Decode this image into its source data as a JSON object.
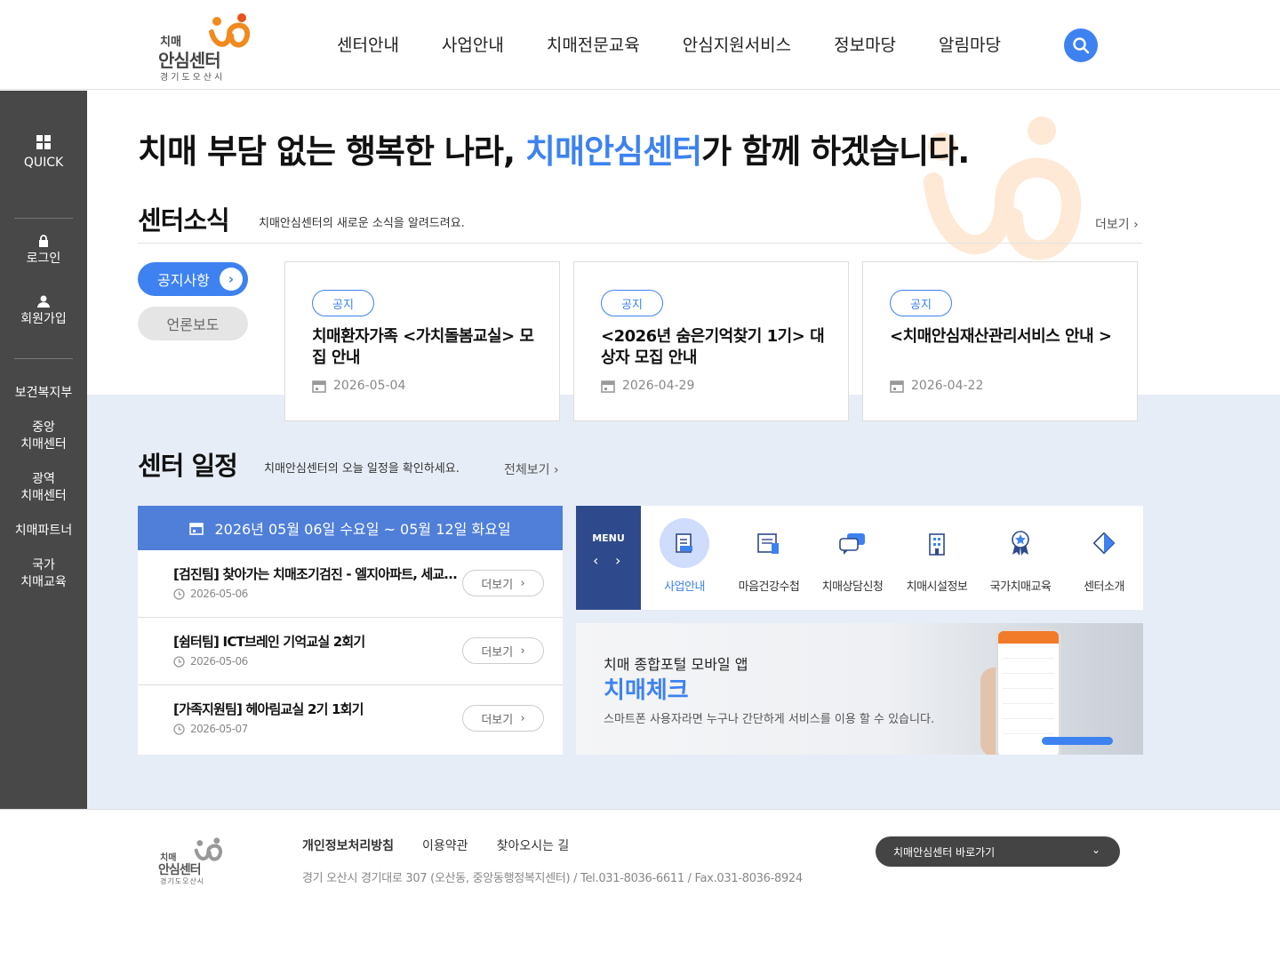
{
  "header": {
    "logo": {
      "line1": "치매",
      "line2": "안심센터",
      "line3": "경기도오산시"
    },
    "nav": [
      "센터안내",
      "사업안내",
      "치매전문교육",
      "안심지원서비스",
      "정보마당",
      "알림마당"
    ],
    "search_icon": "search-icon",
    "accent_color": "#3d82f0"
  },
  "sidebar": {
    "quick": "QUICK",
    "login": "로그인",
    "join": "회원가입",
    "links": [
      "보건복지부",
      "중앙\n치매센터",
      "광역\n치매센터",
      "치매파트너",
      "국가\n치매교육"
    ]
  },
  "hero": {
    "title_pre": "치매 부담 없는 행복한 나라, ",
    "title_hl": "치매안심센터",
    "title_post": "가 함께 하겠습니다."
  },
  "news": {
    "title": "센터소식",
    "desc": "치매안심센터의 새로운 소식을 알려드려요.",
    "more": "더보기",
    "tabs": [
      "공지사항",
      "언론보도"
    ],
    "cards": [
      {
        "badge": "공지",
        "title": "치매환자가족 <가치돌봄교실> 모집 안내",
        "date": "2026-05-04"
      },
      {
        "badge": "공지",
        "title": "<2026년 숨은기억찾기 1기> 대상자 모집 안내",
        "date": "2026-04-29"
      },
      {
        "badge": "공지",
        "title": "<치매안심재산관리서비스 안내 >",
        "date": "2026-04-22"
      }
    ]
  },
  "schedule": {
    "title": "센터 일정",
    "desc": "치매안심센터의 오늘 일정을 확인하세요.",
    "more": "전체보기",
    "range": "2026년 05월 06일 수요일 ~ 05월 12일 화요일",
    "items": [
      {
        "title": "[검진팀] 찾아가는 치매조기검진 - 엘지아파트, 세교…",
        "date": "2026-05-06",
        "btn": "더보기"
      },
      {
        "title": "[쉼터팀] ICT브레인 기억교실 2회기",
        "date": "2026-05-06",
        "btn": "더보기"
      },
      {
        "title": "[가족지원팀] 헤아림교실 2기 1회기",
        "date": "2026-05-07",
        "btn": "더보기"
      }
    ]
  },
  "quick_menu": {
    "label": "MENU",
    "items": [
      "사업안내",
      "마음건강수첩",
      "치매상담신청",
      "치매시설정보",
      "국가치매교육",
      "센터소개"
    ],
    "icons": [
      "document-icon",
      "notebook-icon",
      "chat-icon",
      "building-icon",
      "medal-icon",
      "puzzle-icon"
    ]
  },
  "banner": {
    "subtitle": "치매 종합포털 모바일 앱",
    "title": "치매체크",
    "desc": "스마트폰 사용자라면 누구나 간단하게 서비스를 이용 할 수 있습니다."
  },
  "footer": {
    "logo": {
      "line1": "치매",
      "line2": "안심센터",
      "line3": "경기도오산시"
    },
    "links": [
      "개인정보처리방침",
      "이용약관",
      "찾아오시는 길"
    ],
    "address": "경기 오산시 경기대로 307 (오산동, 중앙동행정복지센터) / Tel.031-8036-6611 / Fax.031-8036-8924",
    "select": "치매안심센터 바로가기"
  }
}
